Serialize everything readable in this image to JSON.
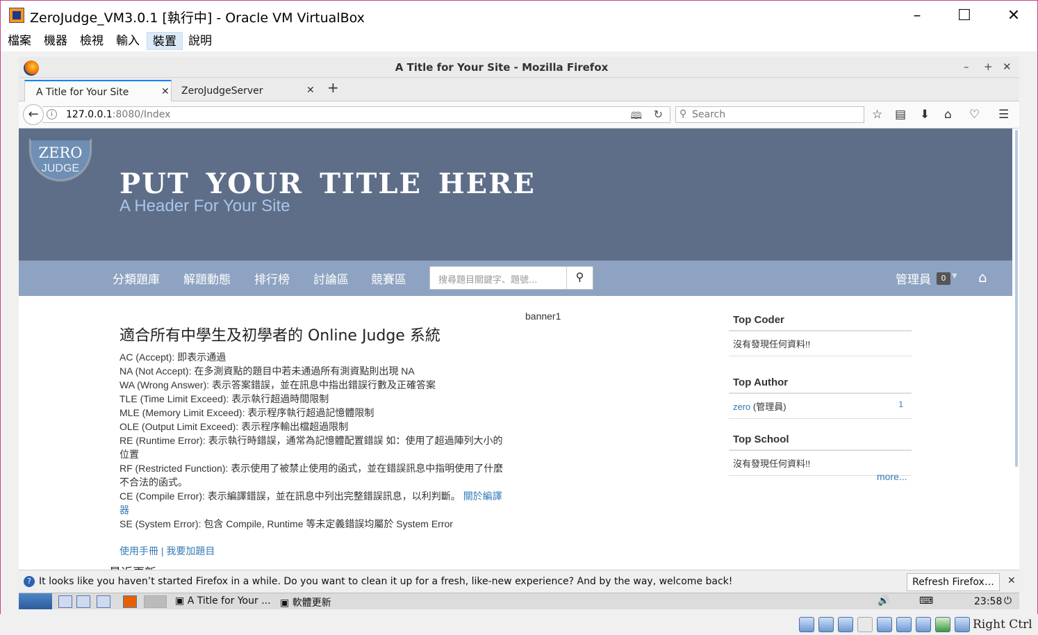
{
  "vbox": {
    "title": "ZeroJudge_VM3.0.1 [執行中] - Oracle VM VirtualBox",
    "menu": [
      "檔案",
      "機器",
      "檢視",
      "輸入",
      "裝置",
      "說明"
    ],
    "status_right": "Right Ctrl"
  },
  "firefox": {
    "window_title": "A Title for Your Site - Mozilla Firefox",
    "tabs": [
      {
        "label": "A Title for Your Site",
        "active": true
      },
      {
        "label": "ZeroJudgeServer",
        "active": false
      }
    ],
    "url_host": "127.0.0.1",
    "url_rest": ":8080/Index",
    "search_placeholder": "Search",
    "notification": "It looks like you haven’t started Firefox in a while. Do you want to clean it up for a fresh, like-new experience? And by the way, welcome back!",
    "refresh_button": "Refresh Firefox…"
  },
  "site": {
    "banner_title": "PUT YOUR TITLE HERE",
    "banner_subtitle": "A Header For Your Site",
    "logo_top": "ZERO",
    "logo_bottom": "JUDGE",
    "nav": [
      "分類題庫",
      "解題動態",
      "排行榜",
      "討論區",
      "競賽區"
    ],
    "search_placeholder": "搜尋題目關鍵字、題號...",
    "user": "管理員",
    "badge": "0",
    "heading": "適合所有中學生及初學者的 Online Judge 系統",
    "lines": [
      "AC (Accept): 即表示通過",
      "NA (Not Accept): 在多測資點的題目中若未通過所有測資點則出現 NA",
      "WA (Wrong Answer): 表示答案錯誤，並在訊息中指出錯誤行數及正確答案",
      "TLE (Time Limit Exceed): 表示執行超過時間限制",
      "MLE (Memory Limit Exceed): 表示程序執行超過記憶體限制",
      "OLE (Output Limit Exceed): 表示程序輸出檔超過限制",
      "RE (Runtime Error): 表示執行時錯誤，通常為記憶體配置錯誤 如：使用了超過陣列大小的位置",
      "RF (Restricted Function): 表示使用了被禁止使用的函式，並在錯誤訊息中指明使用了什麼不合法的函式。",
      "CE (Compile Error): 表示編譯錯誤，並在訊息中列出完整錯誤訊息，以利判斷。",
      "SE (System Error): 包含 Compile, Runtime 等未定義錯誤均屬於 System Error"
    ],
    "compiler_link": "關於編譯器",
    "manual_link": "使用手冊",
    "separator": "|",
    "add_problem_link": "我要加題目",
    "recent": "最近更新",
    "banner_id": "banner1",
    "top_coder": "Top Coder",
    "no_data": "沒有發現任何資料!!",
    "top_author": "Top Author",
    "author_name": "zero",
    "author_role": "(管理員)",
    "author_count": "1",
    "top_school": "Top School",
    "more": "more..."
  },
  "guest_taskbar": {
    "items": [
      "A Title for Your ...",
      "軟體更新"
    ],
    "clock": "23:58"
  }
}
